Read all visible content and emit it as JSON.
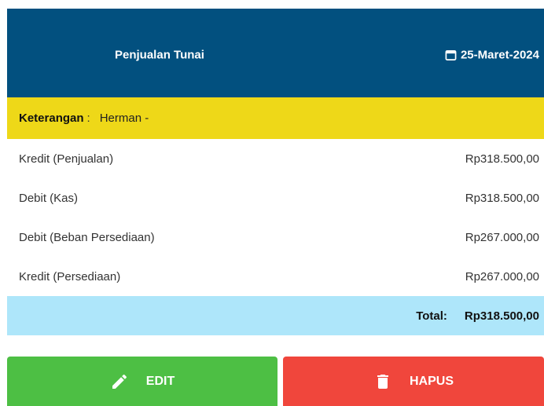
{
  "header": {
    "title": "Penjualan Tunai",
    "date": "25-Maret-2024",
    "date_icon": "calendar-icon",
    "bg_color": "#02507f"
  },
  "note": {
    "label": "Keterangan",
    "colon": ":",
    "value": "Herman -",
    "bg_color": "#eed818"
  },
  "entries": [
    {
      "label": "Kredit (Penjualan)",
      "amount": "Rp318.500,00"
    },
    {
      "label": "Debit (Kas)",
      "amount": "Rp318.500,00"
    },
    {
      "label": "Debit (Beban Persediaan)",
      "amount": "Rp267.000,00"
    },
    {
      "label": "Kredit (Persediaan)",
      "amount": "Rp267.000,00"
    }
  ],
  "total": {
    "label": "Total:",
    "value": "Rp318.500,00",
    "bg_color": "#aee6fa"
  },
  "actions": {
    "edit_label": "EDIT",
    "edit_icon": "pencil-icon",
    "edit_color": "#4dbf44",
    "delete_label": "HAPUS",
    "delete_icon": "trash-icon",
    "delete_color": "#f0463c"
  }
}
